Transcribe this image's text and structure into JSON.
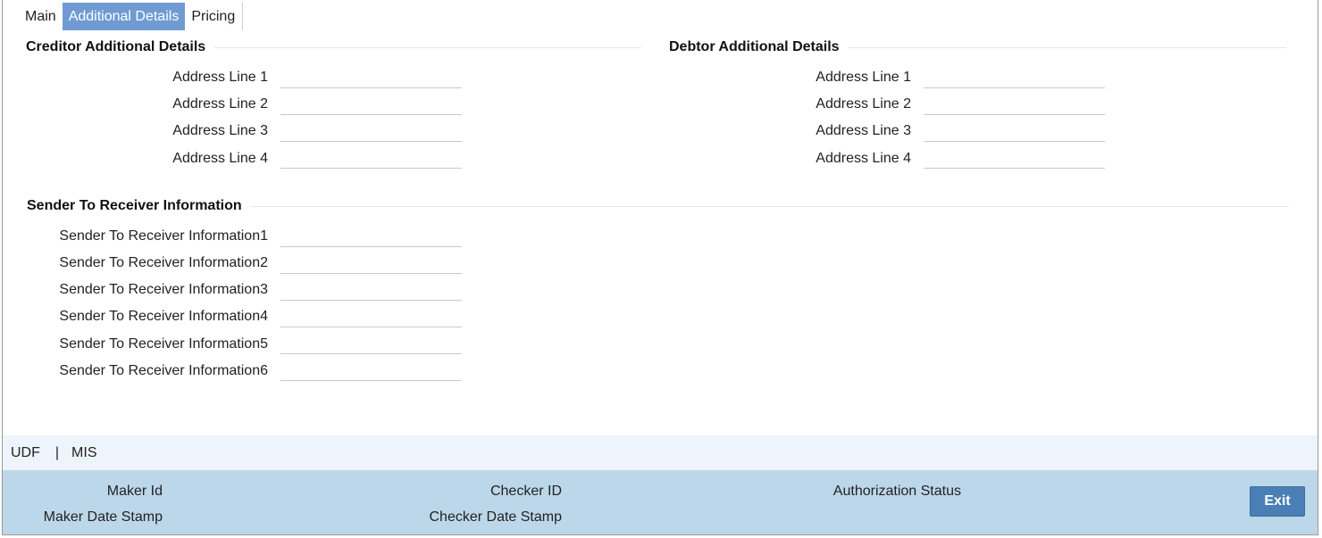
{
  "tabs": [
    {
      "label": "Main",
      "active": false
    },
    {
      "label": "Additional Details",
      "active": true
    },
    {
      "label": "Pricing",
      "active": false
    }
  ],
  "creditor": {
    "title": "Creditor Additional Details",
    "fields": [
      {
        "label": "Address Line 1",
        "value": ""
      },
      {
        "label": "Address Line 2",
        "value": ""
      },
      {
        "label": "Address Line 3",
        "value": ""
      },
      {
        "label": "Address Line 4",
        "value": ""
      }
    ]
  },
  "debtor": {
    "title": "Debtor Additional Details",
    "fields": [
      {
        "label": "Address Line 1",
        "value": ""
      },
      {
        "label": "Address Line 2",
        "value": ""
      },
      {
        "label": "Address Line 3",
        "value": ""
      },
      {
        "label": "Address Line 4",
        "value": ""
      }
    ]
  },
  "sender_receiver": {
    "title": "Sender To Receiver Information",
    "fields": [
      {
        "label": "Sender To Receiver Information1",
        "value": ""
      },
      {
        "label": "Sender To Receiver Information2",
        "value": ""
      },
      {
        "label": "Sender To Receiver Information3",
        "value": ""
      },
      {
        "label": "Sender To Receiver Information4",
        "value": ""
      },
      {
        "label": "Sender To Receiver Information5",
        "value": ""
      },
      {
        "label": "Sender To Receiver Information6",
        "value": ""
      }
    ]
  },
  "links": {
    "udf": "UDF",
    "separator": "|",
    "mis": "MIS"
  },
  "audit": {
    "maker_id": "Maker Id",
    "maker_date_stamp": "Maker Date Stamp",
    "checker_id": "Checker ID",
    "checker_date_stamp": "Checker Date Stamp",
    "authorization_status": "Authorization Status"
  },
  "buttons": {
    "exit": "Exit"
  },
  "colors": {
    "active_tab": "#6f9bd2",
    "link_strip": "#eef4fb",
    "audit_bar": "#bdd7ea",
    "exit_button": "#4a7fb5"
  }
}
